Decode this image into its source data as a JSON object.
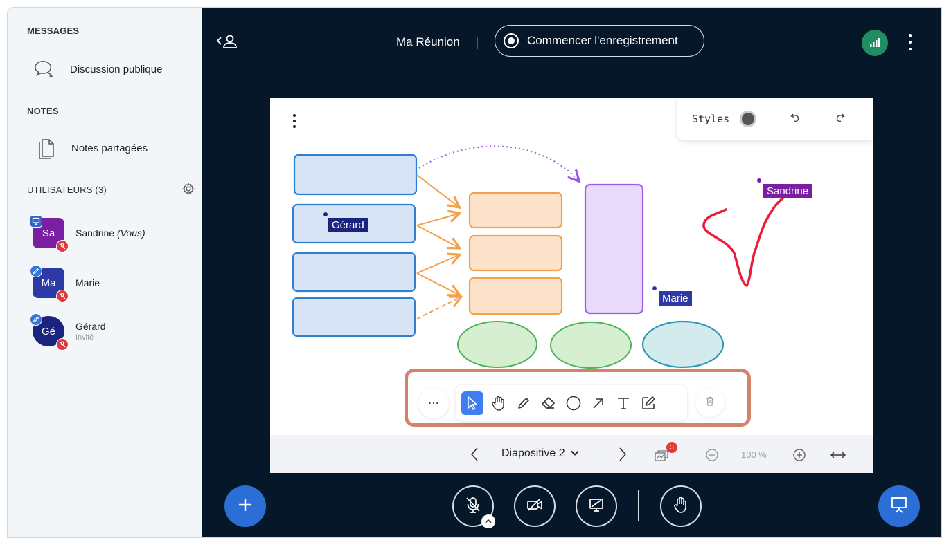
{
  "sidebar": {
    "messages_title": "MESSAGES",
    "public_chat": "Discussion publique",
    "notes_title": "NOTES",
    "shared_notes": "Notes partagées",
    "users_title": "UTILISATEURS (3)",
    "users": [
      {
        "initials": "Sa",
        "name": "Sandrine",
        "suffix": "(Vous)",
        "role": "",
        "color": "#7b1fa2"
      },
      {
        "initials": "Ma",
        "name": "Marie",
        "suffix": "",
        "role": "",
        "color": "#2d3aa5"
      },
      {
        "initials": "Gé",
        "name": "Gérard",
        "suffix": "",
        "role": "Invité",
        "color": "#1a237e"
      }
    ]
  },
  "topbar": {
    "meeting_title": "Ma Réunion",
    "record_label": "Commencer l'enregistrement"
  },
  "whiteboard": {
    "styles_label": "Styles",
    "cursors": [
      {
        "name": "Gérard",
        "color": "#1a237e"
      },
      {
        "name": "Marie",
        "color": "#2d3aa5"
      },
      {
        "name": "Sandrine",
        "color": "#7b1fa2"
      }
    ],
    "tools": [
      "more-tools",
      "select",
      "pan",
      "pencil",
      "eraser",
      "ellipse",
      "arrow",
      "text",
      "note",
      "delete"
    ],
    "active_tool": "select"
  },
  "slide_nav": {
    "slide_label": "Diapositive 2",
    "multiuser_count": "3",
    "zoom": "100 %"
  },
  "colors": {
    "main_bg": "#06172a",
    "accent_blue": "#2b6ed6",
    "toolbar_highlight": "#d4826b",
    "connection_green": "#1f8f63",
    "muted_red": "#e23a3a"
  }
}
